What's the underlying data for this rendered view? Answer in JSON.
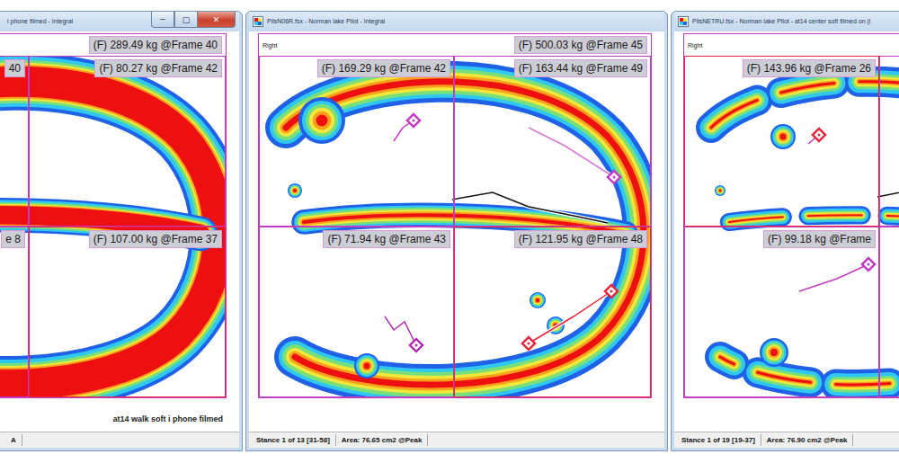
{
  "windows": [
    {
      "title": "i phone filmed - Integral",
      "controls": [
        "─",
        "□",
        "✕"
      ],
      "total": "(F) 289.49 kg @Frame 40",
      "quadrants": [
        {
          "label": "40",
          "color": "#c23bc2"
        },
        {
          "label": "(F) 80.27 kg @Frame 42",
          "color": "#c23bc2"
        },
        {
          "label": "e 8",
          "color": "#c23bc2"
        },
        {
          "label": "(F) 107.00 kg @Frame 37",
          "color": "#e8243c"
        }
      ],
      "note": "at14 walk soft i phone filmed",
      "status": [
        "A"
      ]
    },
    {
      "title": "PilsN06R.fsx - Norman lake Pilot - Integral",
      "side": "Right",
      "total": "(F) 500.03 kg @Frame 45",
      "quadrants": [
        {
          "label": "(F) 169.29 kg @Frame 42",
          "color": "#c23bc2"
        },
        {
          "label": "(F) 163.44 kg @Frame 49",
          "color": "#c23bc2"
        },
        {
          "label": "(F) 71.94 kg @Frame 43",
          "color": "#c23bc2"
        },
        {
          "label": "(F) 121.95 kg @Frame 48",
          "color": "#e8243c"
        }
      ],
      "status": [
        "Stance 1 of 13 [31-58]",
        "Area: 76.65 cm2 @Peak"
      ]
    },
    {
      "title": "PilsNETRU.fsx - Norman lake Pilot - at14 center soft filmed on (i",
      "side": "Right",
      "quadrants": [
        {
          "label": "(F) 143.96 kg @Frame 26",
          "color": "#e8243c"
        },
        {
          "color": "#c23bc2"
        },
        {
          "label": "(F) 99.18 kg @Frame",
          "color": "#c23bc2"
        },
        {
          "color": "#c23bc2"
        }
      ],
      "status": [
        "Stance 1 of 19 [19-37]",
        "Area: 76.90 cm2 @Peak"
      ]
    }
  ]
}
